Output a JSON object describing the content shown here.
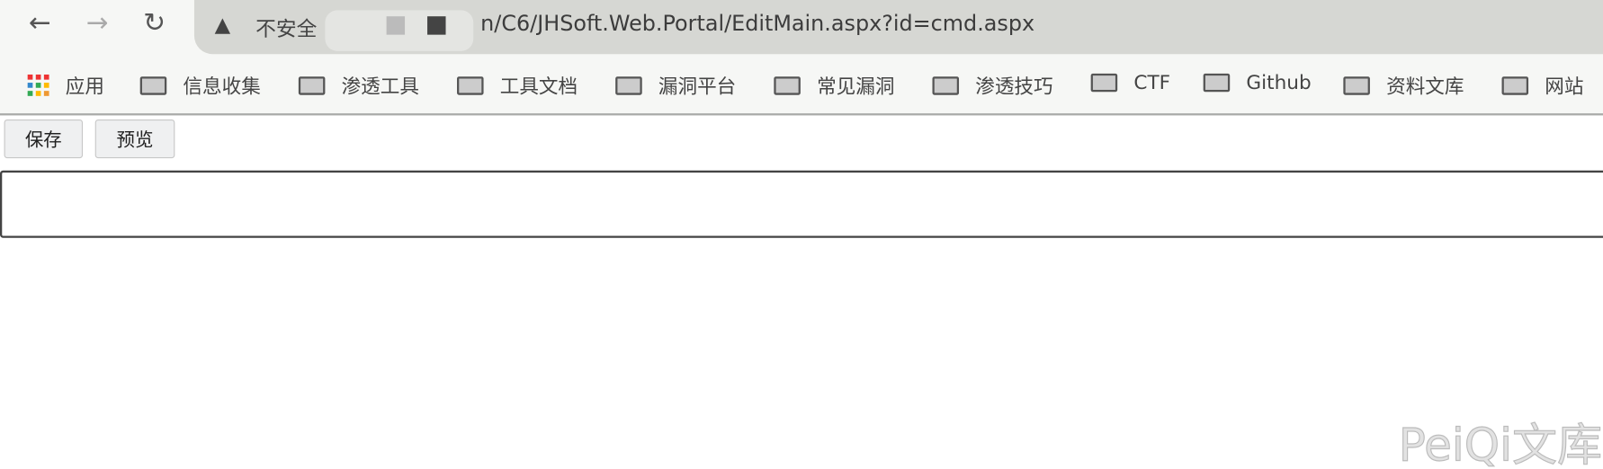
{
  "browser": {
    "security_label": "不安全",
    "url": "/C6/JHSoft.Web.Portal/EditMain.aspx?id=cmd.aspx",
    "url_prefix_partial": "n",
    "bookmarks": [
      {
        "label": "应用",
        "icon": "apps-grid-icon"
      },
      {
        "label": "信息收集",
        "icon": "folder-icon"
      },
      {
        "label": "渗透工具",
        "icon": "folder-icon"
      },
      {
        "label": "工具文档",
        "icon": "folder-icon"
      },
      {
        "label": "漏洞平台",
        "icon": "folder-icon"
      },
      {
        "label": "常见漏洞",
        "icon": "folder-icon"
      },
      {
        "label": "渗透技巧",
        "icon": "folder-icon"
      },
      {
        "label": "CTF",
        "icon": "folder-icon"
      },
      {
        "label": "Github",
        "icon": "folder-icon"
      },
      {
        "label": "资料文库",
        "icon": "folder-icon"
      },
      {
        "label": "网站",
        "icon": "folder-icon"
      }
    ]
  },
  "toolbar": {
    "save_label": "保存",
    "preview_label": "预览"
  },
  "editor": {
    "value": ""
  },
  "watermark": "PeiQi文库"
}
